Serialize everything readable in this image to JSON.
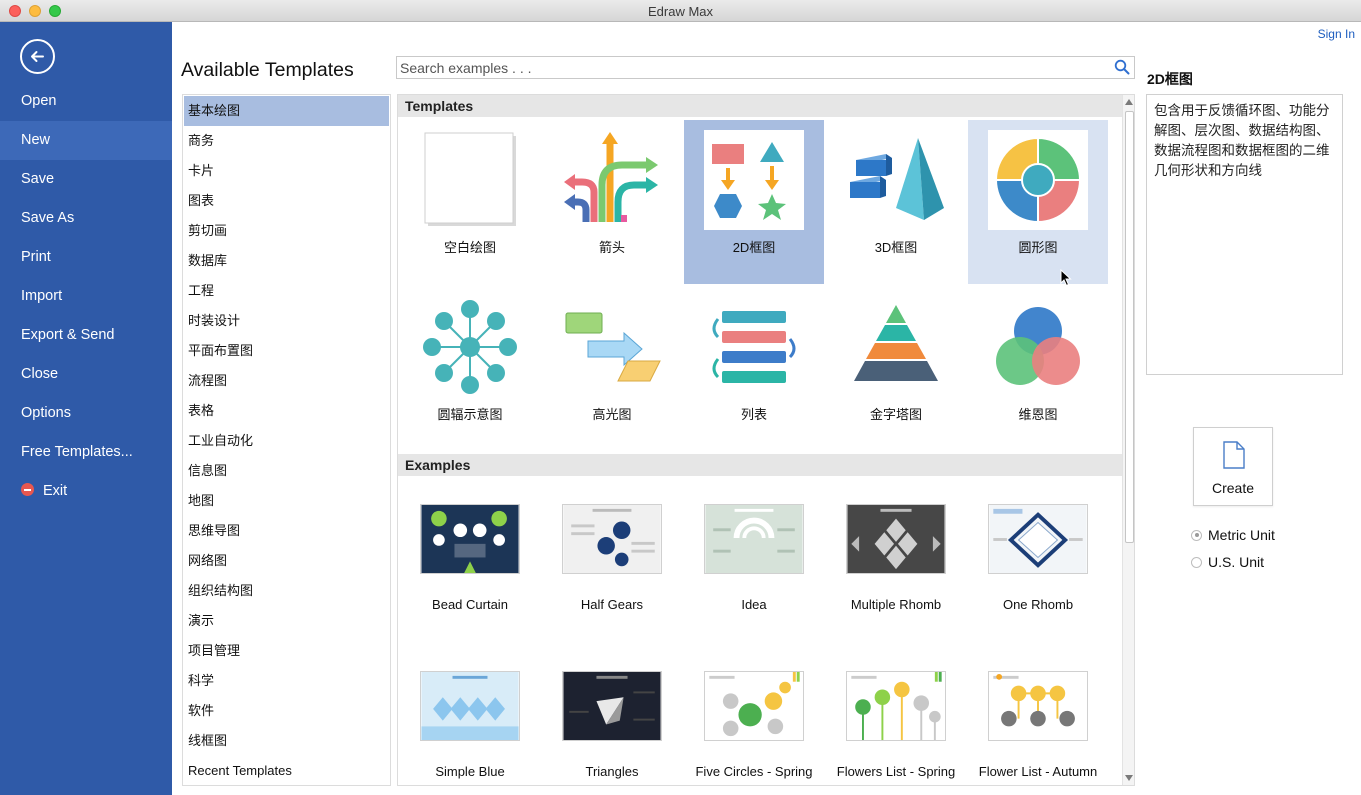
{
  "window": {
    "title": "Edraw Max"
  },
  "nav": {
    "items": [
      {
        "label": "Open"
      },
      {
        "label": "New"
      },
      {
        "label": "Save"
      },
      {
        "label": "Save As"
      },
      {
        "label": "Print"
      },
      {
        "label": "Import"
      },
      {
        "label": "Export & Send"
      },
      {
        "label": "Close"
      },
      {
        "label": "Options"
      },
      {
        "label": "Free Templates..."
      },
      {
        "label": "Exit"
      }
    ],
    "active": "New"
  },
  "header": {
    "signin": "Sign In",
    "title": "Available Templates",
    "search_placeholder": "Search examples . . ."
  },
  "categories": [
    "基本绘图",
    "商务",
    "卡片",
    "图表",
    "剪切画",
    "数据库",
    "工程",
    "时装设计",
    "平面布置图",
    "流程图",
    "表格",
    "工业自动化",
    "信息图",
    "地图",
    "思维导图",
    "网络图",
    "组织结构图",
    "演示",
    "项目管理",
    "科学",
    "软件",
    "线框图",
    "Recent Templates"
  ],
  "selected_category": "基本绘图",
  "templates": {
    "header": "Templates",
    "items": [
      {
        "label": "空白绘图",
        "icon": "blank-page-icon"
      },
      {
        "label": "箭头",
        "icon": "arrows-icon"
      },
      {
        "label": "2D框图",
        "icon": "2d-block-icon"
      },
      {
        "label": "3D框图",
        "icon": "3d-block-icon"
      },
      {
        "label": "圆形图",
        "icon": "circle-diagram-icon"
      },
      {
        "label": "圆辐示意图",
        "icon": "spoke-diagram-icon"
      },
      {
        "label": "高光图",
        "icon": "highlight-icon"
      },
      {
        "label": "列表",
        "icon": "list-icon"
      },
      {
        "label": "金字塔图",
        "icon": "pyramid-icon"
      },
      {
        "label": "维恩图",
        "icon": "venn-icon"
      }
    ],
    "selected": "2D框图",
    "hovered": "圆形图"
  },
  "examples": {
    "header": "Examples",
    "items": [
      {
        "label": "Bead Curtain"
      },
      {
        "label": "Half Gears"
      },
      {
        "label": "Idea"
      },
      {
        "label": "Multiple Rhomb"
      },
      {
        "label": "One Rhomb"
      },
      {
        "label": "Simple Blue"
      },
      {
        "label": "Triangles"
      },
      {
        "label": "Five Circles - Spring"
      },
      {
        "label": "Flowers List - Spring"
      },
      {
        "label": "Flower List - Autumn"
      }
    ]
  },
  "detail": {
    "title": "2D框图",
    "description": "包含用于反馈循环图、功能分解图、层次图、数据结构图、数据流程图和数据框图的二维几何形状和方向线"
  },
  "create": {
    "label": "Create"
  },
  "units": {
    "options": [
      "Metric Unit",
      "U.S. Unit"
    ],
    "selected": "Metric Unit"
  },
  "colors": {
    "nav_bg": "#2f5aa8",
    "nav_active": "#3d69b8",
    "selected": "#a8bde0",
    "hover": "#d8e2f2",
    "link": "#1d5dbf"
  }
}
